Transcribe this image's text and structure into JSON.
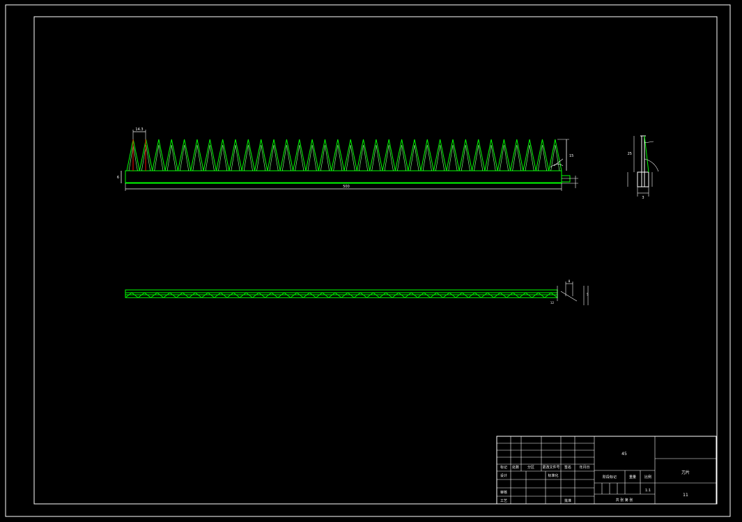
{
  "drawing": {
    "colors": {
      "background": "#000000",
      "frame": "#ffffff",
      "geometry": "#00ff00",
      "geometry_alt": "#7fff7f",
      "dimension": "#ffffff",
      "center_mark": "#ff0000"
    },
    "front_view": {
      "tooth_count": 34,
      "dims": {
        "tooth_pitch": "14.3",
        "overall_length": "500",
        "tooth_height": "15",
        "base_height": "6"
      }
    },
    "side_view": {
      "dims": {
        "height": "25",
        "thickness": "3"
      }
    },
    "top_view": {
      "dims": {
        "width": "8",
        "a": "5",
        "b": "12"
      }
    }
  },
  "title_block": {
    "material": "45",
    "part_name": "刀片",
    "scale": "1:1",
    "drawing_no": "11",
    "row_labels": [
      "标记",
      "处数",
      "分区",
      "更改文件号",
      "签名",
      "年月日"
    ],
    "left_labels": [
      "设计",
      "审核",
      "工艺"
    ],
    "mid_labels": [
      "标准化",
      "批准"
    ],
    "stage_labels": [
      "阶段标记",
      "重量",
      "比例"
    ],
    "sheet_label": "共 张 第 张"
  }
}
